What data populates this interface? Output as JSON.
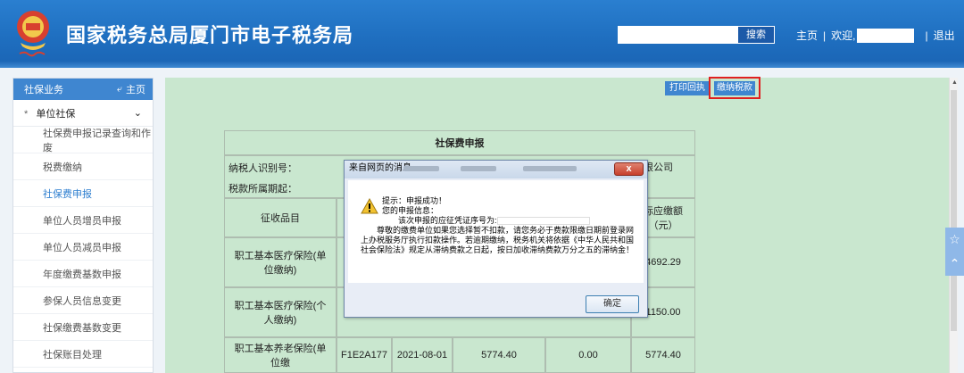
{
  "header": {
    "title": "国家税务总局厦门市电子税务局",
    "search": {
      "placeholder": "",
      "button_label": "搜索"
    },
    "nav": {
      "home": "主页",
      "sep": "|",
      "welcome": "欢迎,",
      "logout": "退出"
    }
  },
  "sidebar": {
    "header_label": "社保业务",
    "home_label": "主页",
    "group_label": "单位社保",
    "items": [
      {
        "label": "社保费申报记录查询和作废"
      },
      {
        "label": "税费缴纳"
      },
      {
        "label": "社保费申报",
        "active": true
      },
      {
        "label": "单位人员增员申报"
      },
      {
        "label": "单位人员减员申报"
      },
      {
        "label": "年度缴费基数申报"
      },
      {
        "label": "参保人员信息变更"
      },
      {
        "label": "社保缴费基数变更"
      },
      {
        "label": "社保账目处理"
      }
    ]
  },
  "actions": {
    "print_label": "打印回执",
    "pay_label": "缴纳税款"
  },
  "form": {
    "title": "社保费申报",
    "taxpayer_id_label": "纳税人识别号：",
    "period_label": "税款所属期起：",
    "company_suffix": "限公司",
    "col_item": "征收品目",
    "col_actual": "际应缴额（元）",
    "rows": [
      {
        "item": "职工基本医疗保险(单位缴纳)",
        "actual": "4692.29"
      },
      {
        "item": "职工基本医疗保险(个人缴纳)",
        "actual": "1150.00"
      },
      {
        "item": "职工基本养老保险(单位缴",
        "code": "F1E2A177",
        "date": "2021-08-01",
        "base": "5774.40",
        "relief": "0.00",
        "actual": "5774.40"
      }
    ]
  },
  "dialog": {
    "title": "来自网页的消息",
    "close_label": "x",
    "line1": "提示：申报成功！",
    "line2": "您的申报信息：",
    "line3": "该次申报的应征凭证序号为:",
    "line4": "尊敬的缴费单位如果您选择暂不扣款，请您务必于费款限缴日期前登录网上办税服务厅执行扣款操作。若逾期缴纳，税务机关将依据《中华人民共和国社会保险法》规定从滞纳费款之日起，按日加收滞纳费款万分之五的滞纳金！",
    "ok_label": "确定"
  },
  "colors": {
    "header_blue": "#1f6fc0",
    "main_green": "#c9e7cf",
    "accent_blue": "#3f86d0",
    "highlight_red": "#e02020"
  }
}
